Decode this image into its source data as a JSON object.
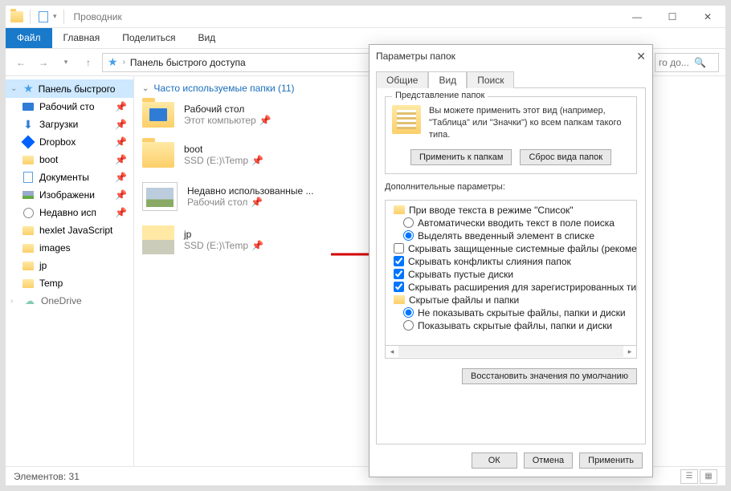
{
  "window": {
    "title": "Проводник",
    "min": "—",
    "max": "☐",
    "close": "✕"
  },
  "ribbon": {
    "file": "Файл",
    "home": "Главная",
    "share": "Поделиться",
    "view": "Вид"
  },
  "address": {
    "path": "Панель быстрого доступа",
    "search_placeholder": "го до..."
  },
  "sidebar": {
    "items": [
      {
        "label": "Панель быстрого"
      },
      {
        "label": "Рабочий сто"
      },
      {
        "label": "Загрузки"
      },
      {
        "label": "Dropbox"
      },
      {
        "label": "boot"
      },
      {
        "label": "Документы"
      },
      {
        "label": "Изображени"
      },
      {
        "label": "Недавно исп"
      },
      {
        "label": "hexlet JavaScript"
      },
      {
        "label": "images"
      },
      {
        "label": "jp"
      },
      {
        "label": "Temp"
      },
      {
        "label": "OneDrive"
      }
    ]
  },
  "content": {
    "group_title": "Часто используемые папки (11)",
    "items": [
      {
        "name": "Рабочий стол",
        "sub": "Этот компьютер",
        "thumb": "desktop"
      },
      {
        "name": "boot",
        "sub": "SSD (E:)\\Temp",
        "thumb": "folder"
      },
      {
        "name": "Недавно использованные ...",
        "sub": "Рабочий стол",
        "thumb": "recent"
      },
      {
        "name": "jp",
        "sub": "SSD (E:)\\Temp",
        "thumb": "jpf"
      }
    ]
  },
  "statusbar": {
    "count": "Элементов: 31"
  },
  "dialog": {
    "title": "Параметры папок",
    "tabs": {
      "general": "Общие",
      "view": "Вид",
      "search": "Поиск"
    },
    "fieldset_legend": "Представление папок",
    "fieldset_text": "Вы можете применить этот вид (например, \"Таблица\" или \"Значки\") ко всем папкам такого типа.",
    "apply_folders": "Применить к папкам",
    "reset_folders": "Сброс вида папок",
    "advanced_label": "Дополнительные параметры:",
    "tree": {
      "group1": "При вводе текста в режиме \"Список\"",
      "r1": "Автоматически вводить текст в поле поиска",
      "r2": "Выделять введенный элемент в списке",
      "c1": "Скрывать защищенные системные файлы (рекомен",
      "c2": "Скрывать конфликты слияния папок",
      "c3": "Скрывать пустые диски",
      "c4": "Скрывать расширения для зарегистрированных типо",
      "group2": "Скрытые файлы и папки",
      "r3": "Не показывать скрытые файлы, папки и диски",
      "r4": "Показывать скрытые файлы, папки и диски"
    },
    "restore": "Восстановить значения по умолчанию",
    "ok": "ОК",
    "cancel": "Отмена",
    "apply": "Применить"
  }
}
